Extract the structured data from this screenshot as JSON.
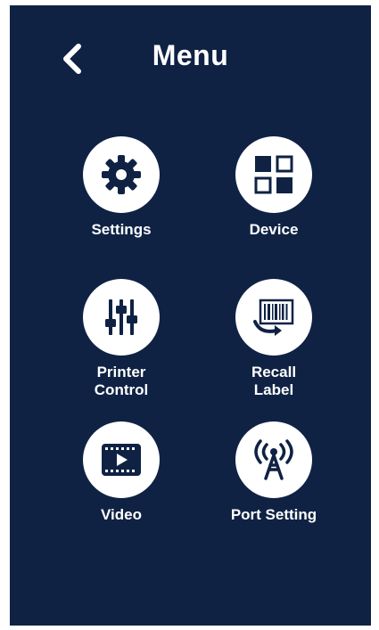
{
  "header": {
    "title": "Menu",
    "back_icon": "chevron-left-icon"
  },
  "menu": {
    "items": [
      {
        "label": "Settings",
        "icon": "gear-icon"
      },
      {
        "label": "Device",
        "icon": "grid-icon"
      },
      {
        "label": "Printer\nControl",
        "icon": "sliders-icon"
      },
      {
        "label": "Recall\nLabel",
        "icon": "barcode-recall-icon"
      },
      {
        "label": "Video",
        "icon": "video-icon"
      },
      {
        "label": "Port Setting",
        "icon": "antenna-icon"
      }
    ]
  },
  "colors": {
    "background": "#0f2244",
    "tile": "#ffffff",
    "text": "#ffffff"
  }
}
